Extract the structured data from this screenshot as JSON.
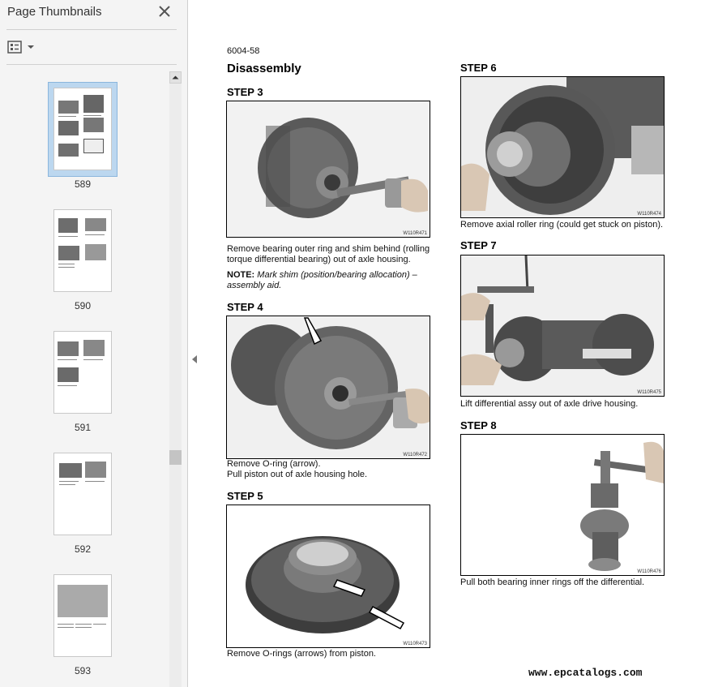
{
  "panel": {
    "title": "Page Thumbnails",
    "thumbnails": [
      {
        "label": "589",
        "selected": true
      },
      {
        "label": "590",
        "selected": false
      },
      {
        "label": "591",
        "selected": false
      },
      {
        "label": "592",
        "selected": false
      },
      {
        "label": "593",
        "selected": false
      }
    ]
  },
  "document": {
    "page_ref": "6004-58",
    "section_title": "Disassembly",
    "steps": [
      {
        "heading": "STEP 3",
        "figure_code": "W110R471",
        "caption": "Remove bearing outer ring and shim behind (rolling torque differential bearing) out of axle housing.",
        "note_label": "NOTE:",
        "note_text": "Mark shim (position/bearing allocation) – assembly aid."
      },
      {
        "heading": "STEP 4",
        "figure_code": "W110R472",
        "caption_line1": "Remove O-ring (arrow).",
        "caption_line2": "Pull piston out of axle housing hole."
      },
      {
        "heading": "STEP 5",
        "figure_code": "W110R473",
        "caption": "Remove O-rings (arrows) from piston."
      },
      {
        "heading": "STEP 6",
        "figure_code": "W110R474",
        "caption": "Remove axial roller ring (could get stuck on piston)."
      },
      {
        "heading": "STEP 7",
        "figure_code": "W110R475",
        "caption": "Lift differential assy out of axle drive housing."
      },
      {
        "heading": "STEP 8",
        "figure_code": "W110R476",
        "caption": "Pull both bearing inner rings off the differential."
      }
    ],
    "watermark": "www.epcatalogs.com"
  },
  "colors": {
    "panel_bg": "#f4f4f4",
    "selection": "#bcd7ef",
    "text": "#111111"
  }
}
